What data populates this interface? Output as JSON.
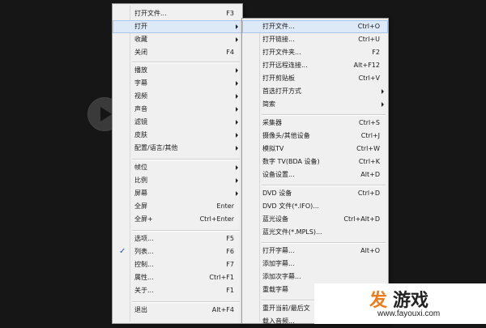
{
  "main_menu": {
    "items": [
      {
        "label": "打开文件...",
        "shortcut": "F3"
      },
      {
        "label": "打开",
        "shortcut": "",
        "submenu": true,
        "highlighted": true
      },
      {
        "label": "收藏",
        "shortcut": "",
        "submenu": true
      },
      {
        "label": "关闭",
        "shortcut": "F4"
      },
      {
        "label": "播放",
        "shortcut": "",
        "submenu": true
      },
      {
        "label": "字幕",
        "shortcut": "",
        "submenu": true
      },
      {
        "label": "视频",
        "shortcut": "",
        "submenu": true
      },
      {
        "label": "声音",
        "shortcut": "",
        "submenu": true
      },
      {
        "label": "滤镜",
        "shortcut": "",
        "submenu": true
      },
      {
        "label": "皮肤",
        "shortcut": "",
        "submenu": true
      },
      {
        "label": "配置/语言/其他",
        "shortcut": "",
        "submenu": true
      },
      {
        "label": "帧位",
        "shortcut": "",
        "submenu": true
      },
      {
        "label": "比例",
        "shortcut": "",
        "submenu": true
      },
      {
        "label": "屏幕",
        "shortcut": "",
        "submenu": true
      },
      {
        "label": "全屏",
        "shortcut": "Enter"
      },
      {
        "label": "全屏+",
        "shortcut": "Ctrl+Enter"
      },
      {
        "label": "选项...",
        "shortcut": "F5"
      },
      {
        "label": "列表...",
        "shortcut": "F6",
        "checked": true
      },
      {
        "label": "控制...",
        "shortcut": "F7"
      },
      {
        "label": "属性...",
        "shortcut": "Ctrl+F1"
      },
      {
        "label": "关于...",
        "shortcut": "F1"
      },
      {
        "label": "退出",
        "shortcut": "Alt+F4"
      }
    ],
    "check_mark": "✓"
  },
  "open_submenu": {
    "items": [
      {
        "label": "打开文件...",
        "shortcut": "Ctrl+O",
        "highlighted": true
      },
      {
        "label": "打开链接...",
        "shortcut": "Ctrl+U"
      },
      {
        "label": "打开文件夹...",
        "shortcut": "F2"
      },
      {
        "label": "打开远程连接...",
        "shortcut": "Alt+F12"
      },
      {
        "label": "打开剪贴板",
        "shortcut": "Ctrl+V"
      },
      {
        "label": "首选打开方式",
        "shortcut": "",
        "submenu": true
      },
      {
        "label": "简索",
        "shortcut": "",
        "submenu": true
      },
      {
        "label": "采集器",
        "shortcut": "Ctrl+S"
      },
      {
        "label": "摄像头/其他设备",
        "shortcut": "Ctrl+J"
      },
      {
        "label": "模拟TV",
        "shortcut": "Ctrl+W"
      },
      {
        "label": "数字 TV(BDA 设备)",
        "shortcut": "Ctrl+K"
      },
      {
        "label": "设备设置...",
        "shortcut": "Alt+D"
      },
      {
        "label": "DVD 设备",
        "shortcut": "Ctrl+D"
      },
      {
        "label": "DVD 文件(*.IFO)...",
        "shortcut": ""
      },
      {
        "label": "蓝光设备",
        "shortcut": "Ctrl+Alt+D"
      },
      {
        "label": "蓝光文件(*.MPLS)...",
        "shortcut": ""
      },
      {
        "label": "打开字幕...",
        "shortcut": "Alt+O"
      },
      {
        "label": "添加字幕...",
        "shortcut": ""
      },
      {
        "label": "添加次字幕...",
        "shortcut": ""
      },
      {
        "label": "重载字幕",
        "shortcut": ""
      },
      {
        "label": "重开当前/最后文",
        "shortcut": ""
      },
      {
        "label": "载入音频...",
        "shortcut": ""
      }
    ]
  },
  "watermark": {
    "mark": "发",
    "text": "游戏",
    "url": "www.fayouxi.com"
  },
  "colors": {
    "background": "#161616",
    "menu_bg": "#f0f0f0",
    "highlight": "#dde9f7",
    "logo_orange": "#e97c1d"
  }
}
